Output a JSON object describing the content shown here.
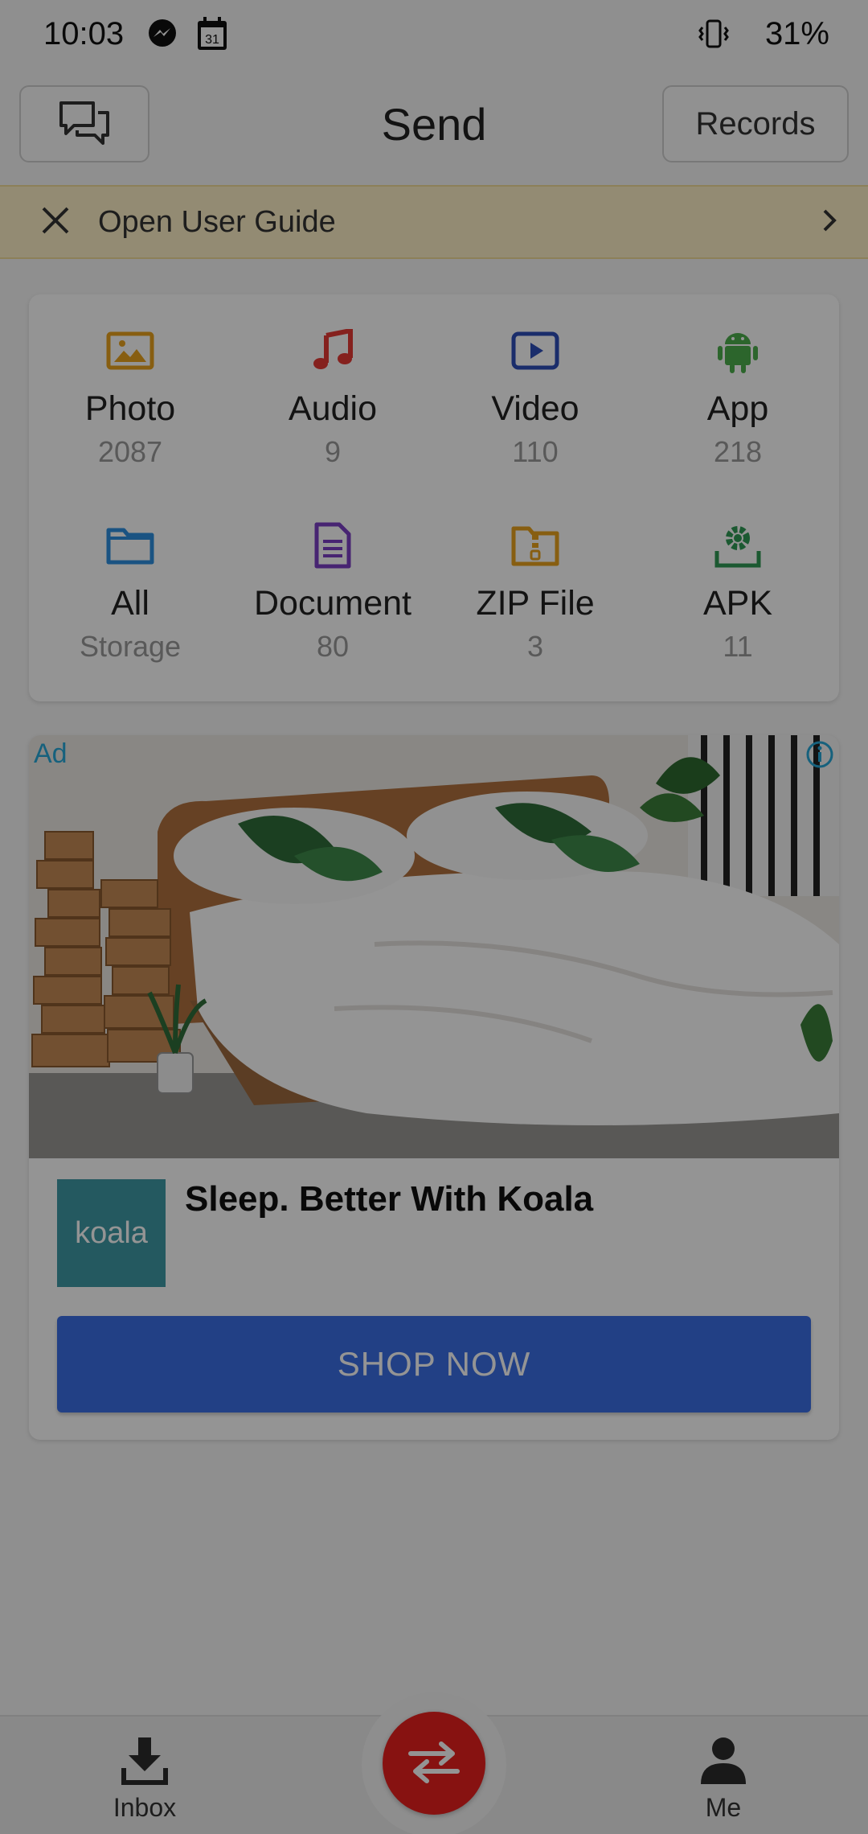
{
  "status_bar": {
    "time": "10:03",
    "battery": "31%",
    "icons": [
      "messenger-icon",
      "calendar-icon",
      "vibrate-icon"
    ],
    "calendar_day": "31"
  },
  "header": {
    "title": "Send",
    "records_label": "Records",
    "chat_icon": "chat-bubbles-icon"
  },
  "guide_banner": {
    "label": "Open User Guide"
  },
  "categories": [
    {
      "name": "Photo",
      "count": "2087",
      "icon": "image-icon",
      "color": "#e9a21e"
    },
    {
      "name": "Audio",
      "count": "9",
      "icon": "music-note-icon",
      "color": "#e53935"
    },
    {
      "name": "Video",
      "count": "110",
      "icon": "play-icon",
      "color": "#2e4fb8"
    },
    {
      "name": "App",
      "count": "218",
      "icon": "android-icon",
      "color": "#4cae4c"
    },
    {
      "name": "All",
      "count": "Storage",
      "icon": "folder-icon",
      "color": "#2e8fe0"
    },
    {
      "name": "Document",
      "count": "80",
      "icon": "document-icon",
      "color": "#7b3fc4"
    },
    {
      "name": "ZIP File",
      "count": "3",
      "icon": "zip-folder-icon",
      "color": "#e9a21e"
    },
    {
      "name": "APK",
      "count": "11",
      "icon": "gear-install-icon",
      "color": "#2f9a55"
    }
  ],
  "ad": {
    "badge": "Ad",
    "brand": "koala",
    "headline": "Sleep. Better With Koala",
    "cta": "SHOP NOW",
    "brand_color": "#3f9aa6",
    "cta_color": "#3b6fe6"
  },
  "bottom_nav": {
    "inbox_label": "Inbox",
    "me_label": "Me",
    "fab_icon": "swap-arrows-icon",
    "fab_color": "#e8201e"
  }
}
